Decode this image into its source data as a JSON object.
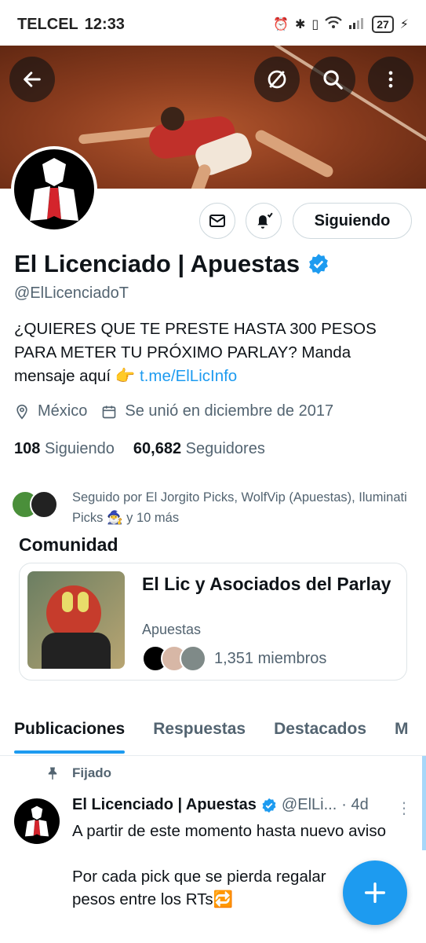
{
  "status_bar": {
    "carrier": "TELCEL",
    "time": "12:33",
    "battery": "27"
  },
  "profile": {
    "name": "El Licenciado | Apuestas",
    "handle": "@ElLicenciadoT",
    "bio_text": "¿QUIERES QUE TE PRESTE HASTA 300 PESOS PARA METER TU PRÓXIMO PARLAY? Manda mensaje aquí 👉 ",
    "bio_link": "t.me/ElLicInfo",
    "location": "México",
    "joined": "Se unió en diciembre de 2017",
    "following_count": "108",
    "following_label": "Siguiendo",
    "followers_count": "60,682",
    "followers_label": "Seguidores",
    "followed_by": "Seguido por El Jorgito Picks, WolfVip (Apuestas), Iluminati Picks 🧙‍♂️ y 10 más",
    "following_button": "Siguiendo"
  },
  "community": {
    "section_title": "Comunidad",
    "name": "El Lic y Asociados del Parlay",
    "category": "Apuestas",
    "members": "1,351 miembros"
  },
  "tabs": [
    {
      "label": "Publicaciones"
    },
    {
      "label": "Respuestas"
    },
    {
      "label": "Destacados"
    },
    {
      "label": "M"
    }
  ],
  "post": {
    "pinned_label": "Fijado",
    "author": "El Licenciado | Apuestas",
    "handle": "@ElLi...",
    "time": "· 4d",
    "text": "A partir de este momento hasta nuevo aviso\n\nPor cada pick que se pierda regalar\npesos entre los RTs🔁"
  },
  "colors": {
    "accent": "#1d9bf0",
    "text": "#0f1419",
    "muted": "#536471"
  }
}
